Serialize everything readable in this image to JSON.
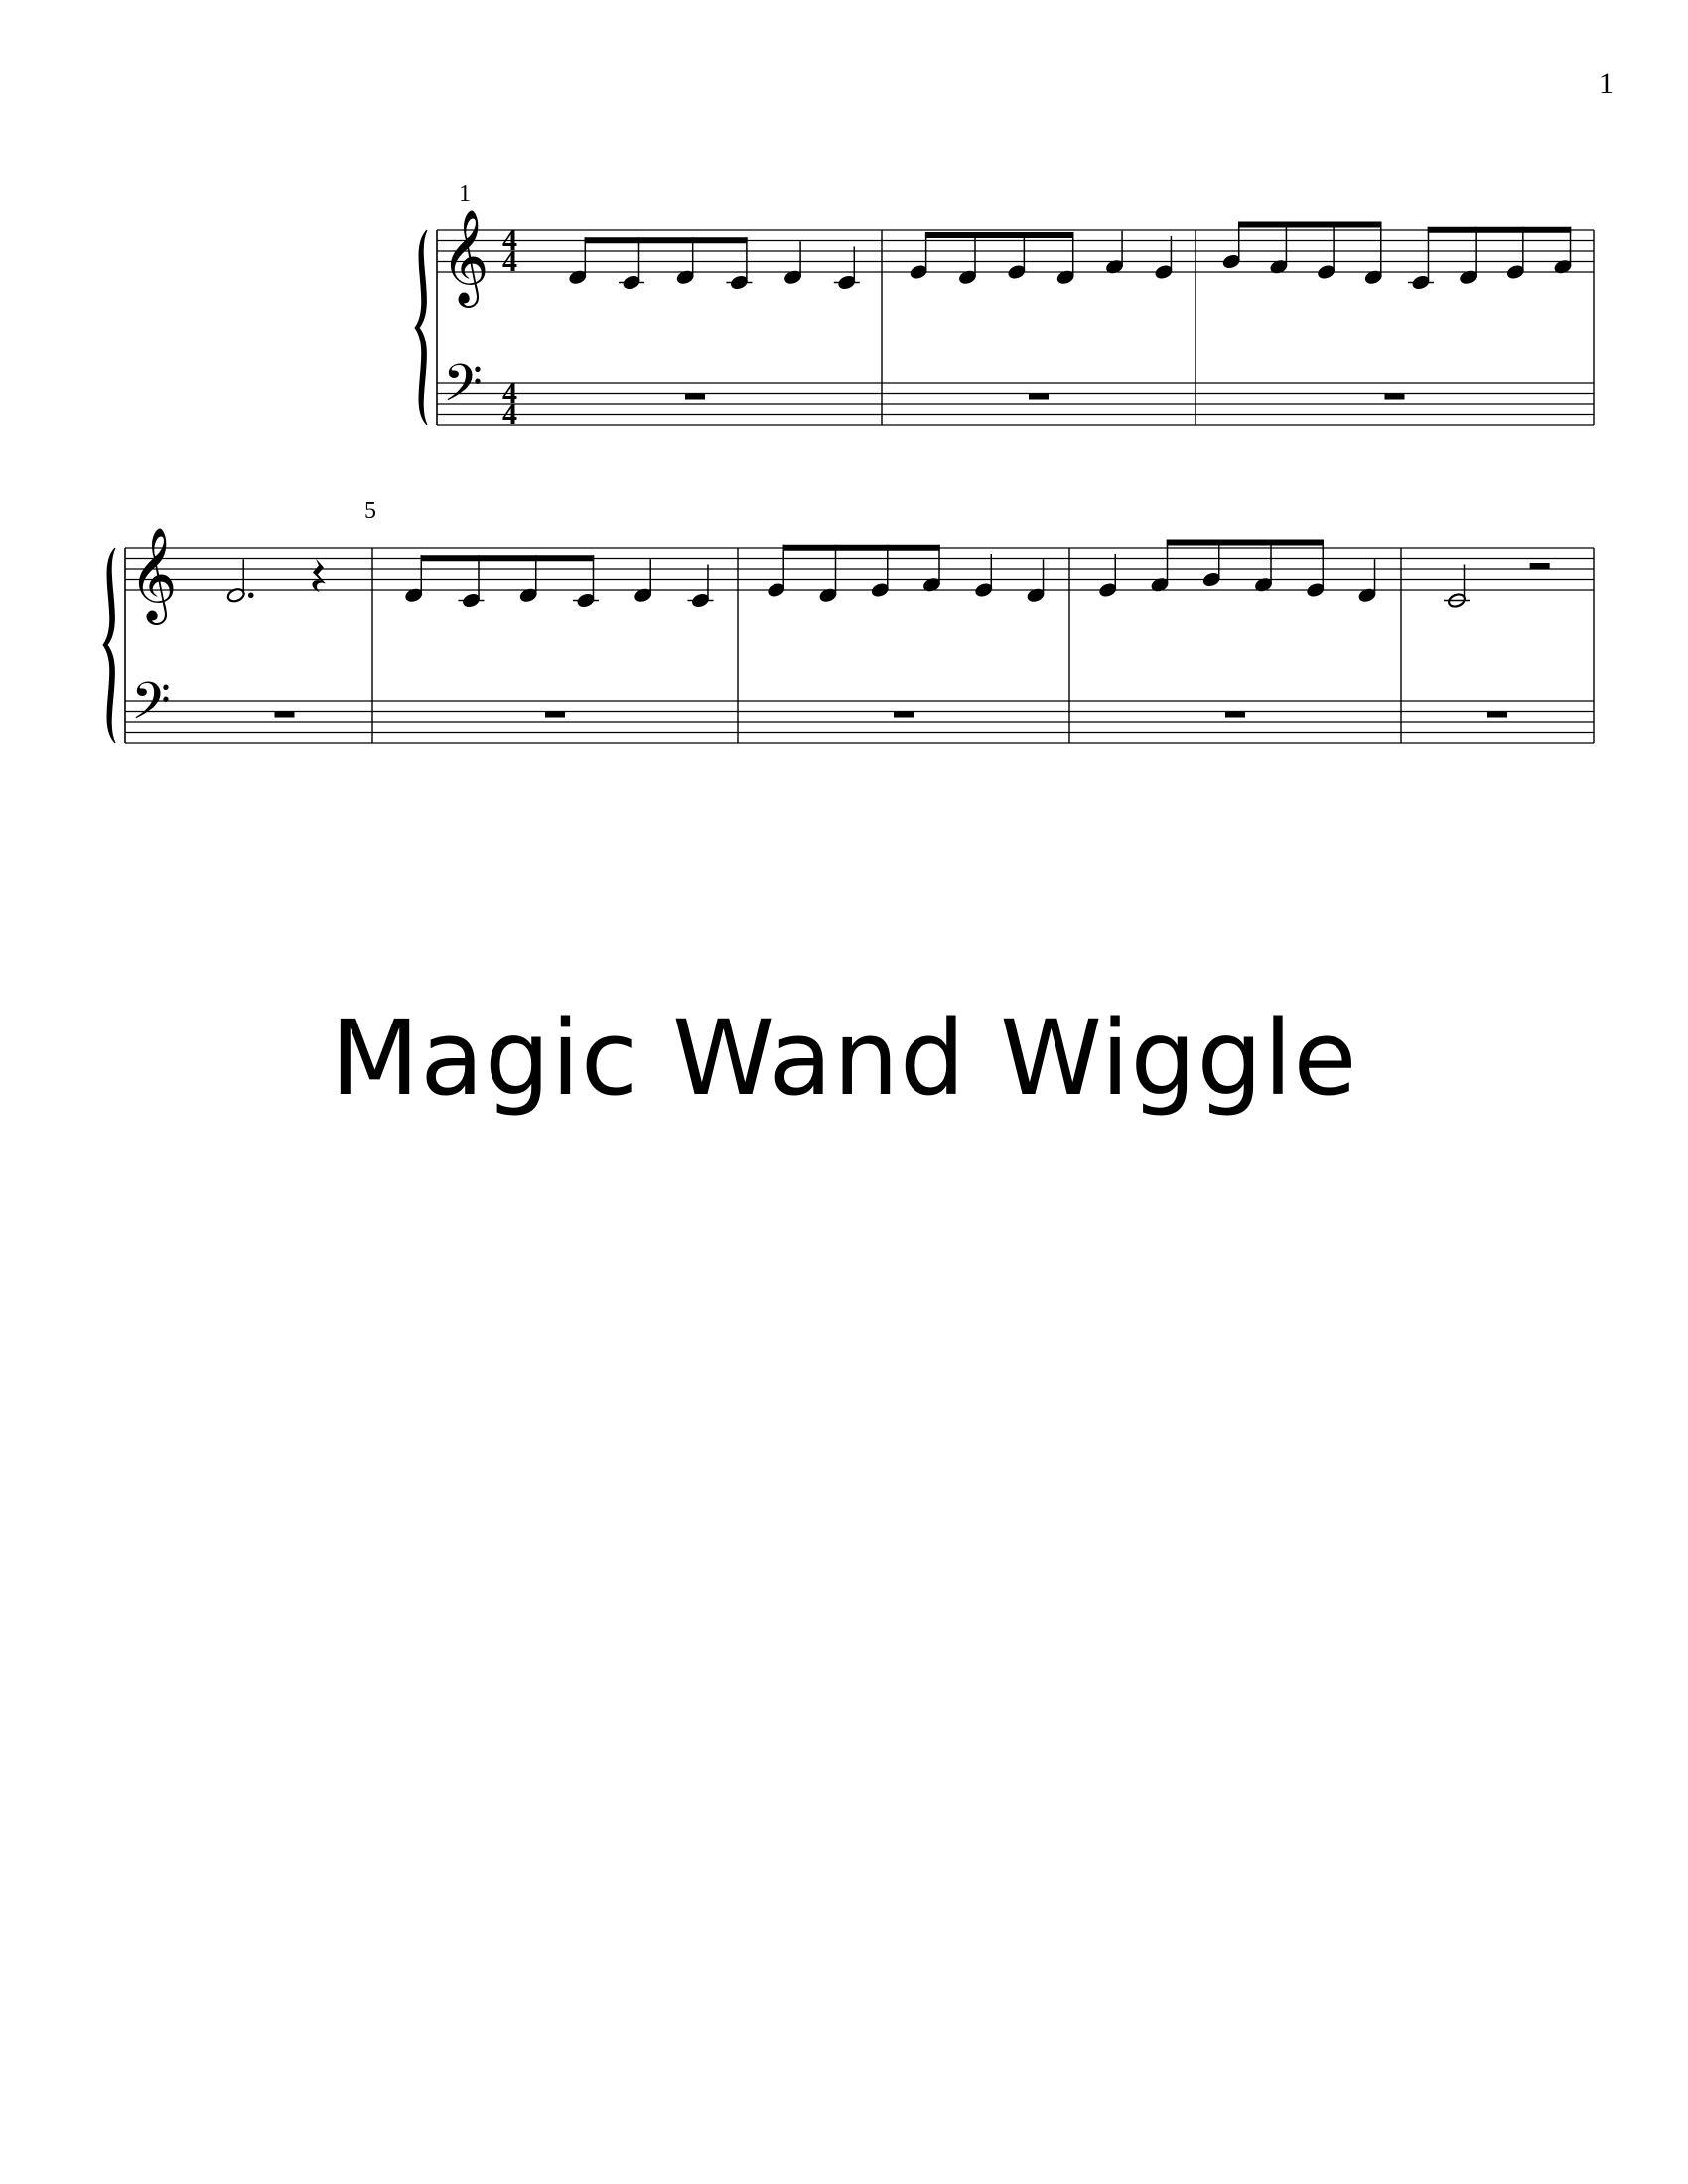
{
  "page_number": "1",
  "title": "Magic Wand Wiggle",
  "time_signature": {
    "beats": "4",
    "beat_unit": "4"
  },
  "systems": [
    {
      "start_measure_label": "1",
      "first_measure": 1,
      "measures": [
        1,
        2,
        3
      ]
    },
    {
      "start_measure_label": "5",
      "first_measure": 4,
      "measures": [
        4,
        5,
        6,
        7,
        8
      ]
    }
  ],
  "treble_measures": [
    {
      "number": 1,
      "notes": [
        "D4/8",
        "C4/8",
        "D4/8",
        "C4/8",
        "D4/4",
        "C4/4"
      ]
    },
    {
      "number": 2,
      "notes": [
        "E4/8",
        "D4/8",
        "E4/8",
        "D4/8",
        "F4/4",
        "E4/4"
      ]
    },
    {
      "number": 3,
      "notes": [
        "G4/8",
        "F4/8",
        "E4/8",
        "D4/8",
        "C4/8",
        "D4/8",
        "E4/8",
        "F4/8"
      ]
    },
    {
      "number": 4,
      "notes": [
        "D4/2.",
        "rest/4"
      ]
    },
    {
      "number": 5,
      "notes": [
        "D4/8",
        "C4/8",
        "D4/8",
        "C4/8",
        "D4/4",
        "C4/4"
      ]
    },
    {
      "number": 6,
      "notes": [
        "E4/8",
        "D4/8",
        "E4/8",
        "F4/8",
        "E4/4",
        "D4/4"
      ]
    },
    {
      "number": 7,
      "notes": [
        "E4/4",
        "F4/8",
        "G4/8",
        "F4/8",
        "E4/8",
        "D4/4"
      ]
    },
    {
      "number": 8,
      "notes": [
        "C4/2",
        "rest/2"
      ]
    }
  ],
  "bass_measures": [
    {
      "number": 1,
      "notes": [
        "rest/1"
      ]
    },
    {
      "number": 2,
      "notes": [
        "rest/1"
      ]
    },
    {
      "number": 3,
      "notes": [
        "rest/1"
      ]
    },
    {
      "number": 4,
      "notes": [
        "rest/1"
      ]
    },
    {
      "number": 5,
      "notes": [
        "rest/1"
      ]
    },
    {
      "number": 6,
      "notes": [
        "rest/1"
      ]
    },
    {
      "number": 7,
      "notes": [
        "rest/1"
      ]
    },
    {
      "number": 8,
      "notes": [
        "rest/1"
      ]
    }
  ]
}
